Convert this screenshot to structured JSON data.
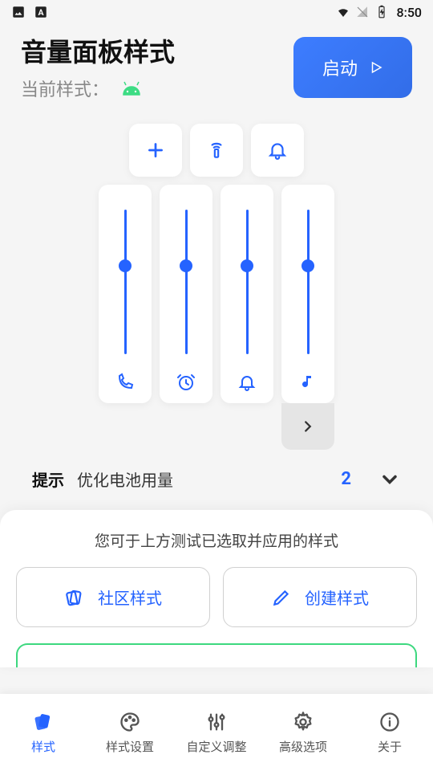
{
  "status": {
    "time": "8:50"
  },
  "header": {
    "title": "音量面板样式",
    "subtitle": "当前样式：",
    "launch_label": "启动"
  },
  "sliders": [
    {
      "icon": "phone",
      "value": 65
    },
    {
      "icon": "alarm",
      "value": 65
    },
    {
      "icon": "bell",
      "value": 65
    },
    {
      "icon": "music",
      "value": 65
    }
  ],
  "hint": {
    "label": "提示",
    "text": "优化电池用量",
    "count": "2"
  },
  "card": {
    "hint": "您可于上方测试已选取并应用的样式",
    "community_label": "社区样式",
    "create_label": "创建样式"
  },
  "nav": {
    "style": "样式",
    "style_settings": "样式设置",
    "custom": "自定义调整",
    "advanced": "高级选项",
    "about": "关于"
  }
}
